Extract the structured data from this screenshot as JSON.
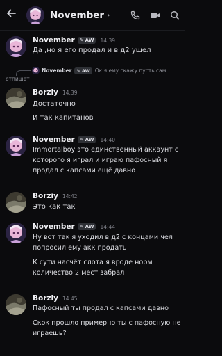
{
  "header": {
    "back_icon": "arrow-left-icon",
    "title": "November",
    "chevron": "›",
    "icons": [
      "phone-icon",
      "video-icon",
      "search-icon"
    ]
  },
  "colors": {
    "background": "#0b0b0d",
    "name": "#f0f0f4",
    "timestamp": "#80828a",
    "badge_bg": "#2e3035"
  },
  "messages": [
    {
      "author": "November",
      "badge": "AW",
      "time": "14:39",
      "lines": [
        "Да ,но я его продал и в д2 ушел"
      ]
    },
    {
      "reply": {
        "author": "November",
        "badge": "AW",
        "text": "Ок я ему скажу пусть сам",
        "text_cont": "отпишет"
      },
      "author": "Borziy",
      "time": "14:39",
      "lines": [
        "Достаточно",
        "И так капитанов"
      ]
    },
    {
      "author": "November",
      "badge": "AW",
      "time": "14:40",
      "lines": [
        "Immortalboy это единственный аккаунт с которого я играл и играю пафосный я продал с капсами ещё давно"
      ]
    },
    {
      "author": "Borziy",
      "time": "14:42",
      "lines": [
        "Это как так"
      ]
    },
    {
      "author": "November",
      "badge": "AW",
      "time": "14:44",
      "lines": [
        "Ну вот так я уходил в д2 с концами чел попросил ему акк продать",
        "К сути насчёт слота я вроде норм количество 2 мест забрал"
      ]
    },
    {
      "author": "Borziy",
      "time": "14:45",
      "lines": [
        "Пафосный ты продал с капсами давно",
        "Скок прошло примерно ты с пафосную не играешь?"
      ]
    }
  ]
}
